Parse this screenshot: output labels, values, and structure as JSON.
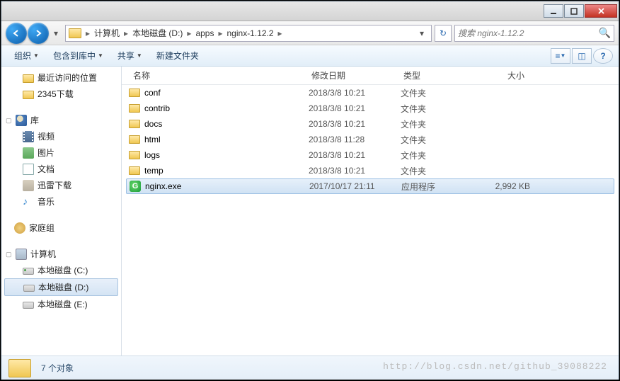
{
  "titlebar": {},
  "nav": {
    "crumbs": [
      "计算机",
      "本地磁盘 (D:)",
      "apps",
      "nginx-1.12.2"
    ],
    "search_placeholder": "搜索 nginx-1.12.2"
  },
  "toolbar": {
    "organize": "组织",
    "include": "包含到库中",
    "share": "共享",
    "newfolder": "新建文件夹"
  },
  "sidebar": {
    "recent": "最近访问的位置",
    "dl2345": "2345下载",
    "libraries": "库",
    "videos": "视频",
    "pictures": "图片",
    "documents": "文档",
    "xunlei": "迅雷下载",
    "music": "音乐",
    "homegroup": "家庭组",
    "computer": "计算机",
    "drive_c": "本地磁盘 (C:)",
    "drive_d": "本地磁盘 (D:)",
    "drive_e": "本地磁盘 (E:)"
  },
  "columns": {
    "name": "名称",
    "date": "修改日期",
    "type": "类型",
    "size": "大小"
  },
  "files": [
    {
      "name": "conf",
      "date": "2018/3/8 10:21",
      "type": "文件夹",
      "size": ""
    },
    {
      "name": "contrib",
      "date": "2018/3/8 10:21",
      "type": "文件夹",
      "size": ""
    },
    {
      "name": "docs",
      "date": "2018/3/8 10:21",
      "type": "文件夹",
      "size": ""
    },
    {
      "name": "html",
      "date": "2018/3/8 11:28",
      "type": "文件夹",
      "size": ""
    },
    {
      "name": "logs",
      "date": "2018/3/8 10:21",
      "type": "文件夹",
      "size": ""
    },
    {
      "name": "temp",
      "date": "2018/3/8 10:21",
      "type": "文件夹",
      "size": ""
    },
    {
      "name": "nginx.exe",
      "date": "2017/10/17 21:11",
      "type": "应用程序",
      "size": "2,992 KB",
      "exe": true,
      "sel": true
    }
  ],
  "status": {
    "count": "7 个对象"
  },
  "watermark": "http://blog.csdn.net/github_39088222"
}
